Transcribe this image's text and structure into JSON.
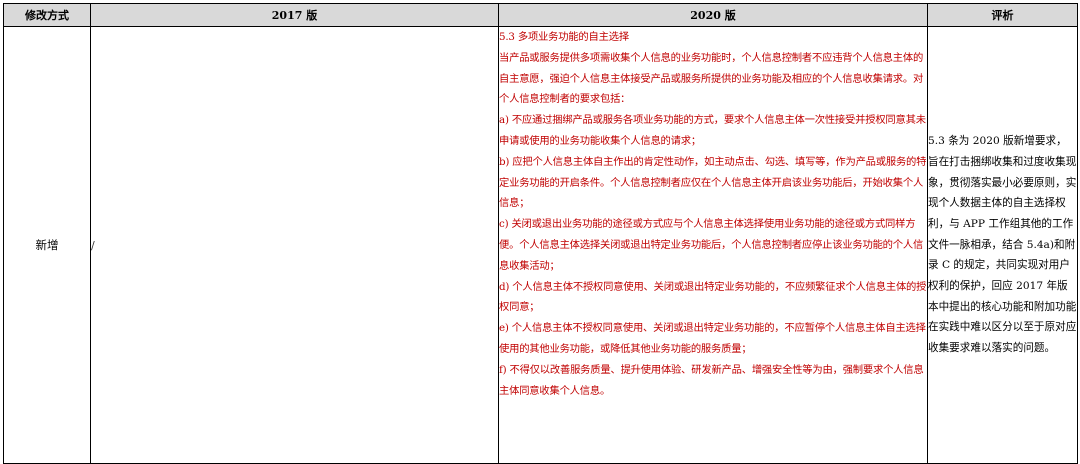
{
  "table": {
    "headers": [
      "修改方式",
      "2017 版",
      "2020 版",
      "评析"
    ],
    "row": {
      "method": "新增",
      "v2017": "/",
      "v2020": [
        "5.3 多项业务功能的自主选择",
        "当产品或服务提供多项需收集个人信息的业务功能时，个人信息控制者不应违背个人信息主体的自主意愿，强迫个人信息主体接受产品或服务所提供的业务功能及相应的个人信息收集请求。对个人信息控制者的要求包括：",
        "a) 不应通过捆绑产品或服务各项业务功能的方式，要求个人信息主体一次性接受并授权同意其未申请或使用的业务功能收集个人信息的请求；",
        "b) 应把个人信息主体自主作出的肯定性动作，如主动点击、勾选、填写等，作为产品或服务的特定业务功能的开启条件。个人信息控制者应仅在个人信息主体开启该业务功能后，开始收集个人信息；",
        "c) 关闭或退出业务功能的途径或方式应与个人信息主体选择使用业务功能的途径或方式同样方便。个人信息主体选择关闭或退出特定业务功能后，个人信息控制者应停止该业务功能的个人信息收集活动；",
        "d) 个人信息主体不授权同意使用、关闭或退出特定业务功能的，不应频繁征求个人信息主体的授权同意；",
        "e) 个人信息主体不授权同意使用、关闭或退出特定业务功能的，不应暂停个人信息主体自主选择使用的其他业务功能，或降低其他业务功能的服务质量；",
        "f) 不得仅以改善服务质量、提升使用体验、研发新产品、增强安全性等为由，强制要求个人信息主体同意收集个人信息。"
      ],
      "comment": "5.3 条为 2020 版新增要求，旨在打击捆绑收集和过度收集现象，贯彻落实最小必要原则，实现个人数据主体的自主选择权利，与 APP 工作组其他的工作文件一脉相承，结合 5.4a)和附录 C 的规定，共同实现对用户权利的保护，回应 2017 年版本中提出的核心功能和附加功能在实践中难以区分以至于原对应收集要求难以落实的问题。"
    }
  },
  "colors": {
    "header_bg": "#d9d9d9",
    "highlight_text": "#c00000",
    "border": "#000000"
  }
}
